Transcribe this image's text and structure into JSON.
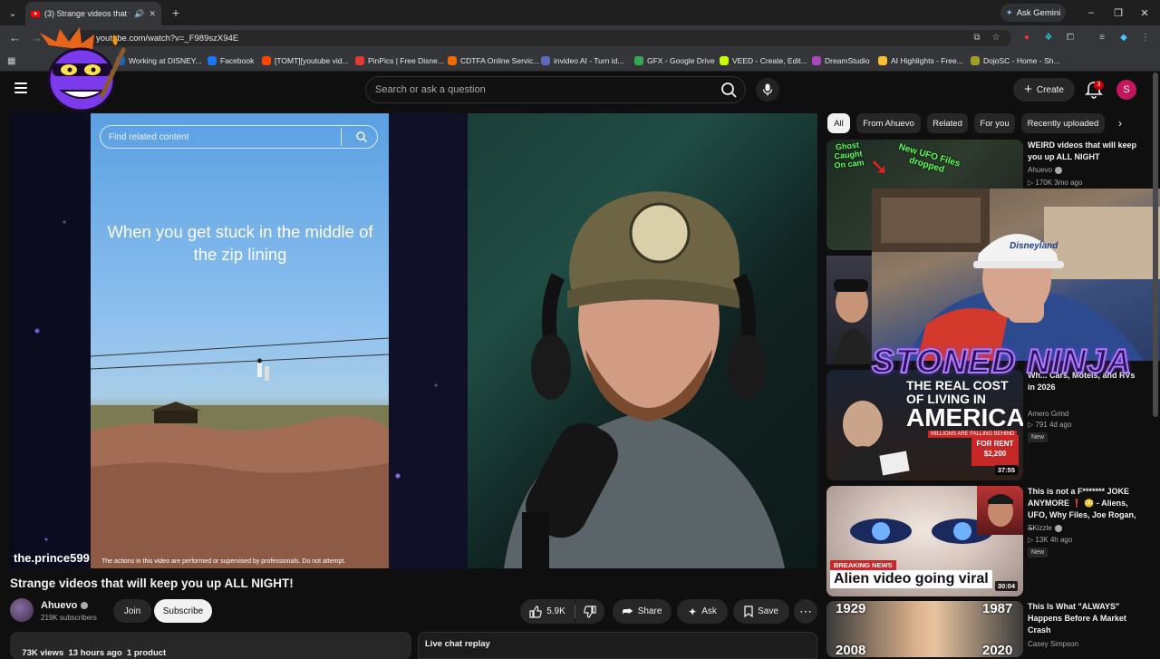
{
  "browser": {
    "tab_title": "(3) Strange videos that will keep you up ALL NIGHT! - YouTube",
    "url": "youtube.com/watch?v=_F989szX94E",
    "ask_gemini": "Ask Gemini",
    "window_minimize": "–",
    "window_maximize": "❐",
    "window_close": "✕",
    "bookmarks": [
      {
        "label": "Working at DISNEY...",
        "color": "#1565c0"
      },
      {
        "label": "Facebook",
        "color": "#1877f2"
      },
      {
        "label": "[TOMT][youtube vid...",
        "color": "#ff4500"
      },
      {
        "label": "PinPics | Free Disne...",
        "color": "#e53935"
      },
      {
        "label": "CDTFA Online Servic...",
        "color": "#ef6c00"
      },
      {
        "label": "invideo AI - Turn id...",
        "color": "#5c6bc0"
      },
      {
        "label": "GFX - Google Drive",
        "color": "#34a853"
      },
      {
        "label": "VEED - Create, Edit...",
        "color": "#c6ff00"
      },
      {
        "label": "DreamStudio",
        "color": "#ab47bc"
      },
      {
        "label": "AI Highlights - Free...",
        "color": "#fbc02d"
      },
      {
        "label": "DojoSC - Home - Sh...",
        "color": "#9e9d24"
      }
    ]
  },
  "header": {
    "search_placeholder": "Search or ask a question",
    "create_label": "Create",
    "notification_count": "3",
    "avatar_letter": "S"
  },
  "player": {
    "phone_search_placeholder": "Find related content",
    "caption": "When you get stuck in the middle of the zip lining",
    "handle": "the.prince599",
    "disclaimer": "The actions in this video are performed or supervised by professionals. Do not attempt."
  },
  "video": {
    "title": "Strange videos that will keep you up ALL NIGHT!",
    "channel": "Ahuevo",
    "subscribers": "219K subscribers",
    "join_label": "Join",
    "subscribe_label": "Subscribe",
    "likes": "5.9K",
    "share_label": "Share",
    "ask_label": "Ask",
    "save_label": "Save",
    "description_line": "73K views  13 hours ago  1 product",
    "live_chat_label": "Live chat replay"
  },
  "chips": [
    "All",
    "From Ahuevo",
    "Related",
    "For you",
    "Recently uploaded"
  ],
  "recommendations": [
    {
      "title": "WEIRD videos that will keep you up ALL NIGHT",
      "channel": "Ahuevo",
      "stats": "▷ 170K  3mo ago",
      "thumb_texts": [
        "Ghost Caught On cam",
        "New UFO Files dropped"
      ]
    },
    {
      "title": "Wh... Cars, Motels, and RVs in 2026",
      "channel": "Amero Grind",
      "stats": "▷ 791  4d ago",
      "badge": "New",
      "duration": "37:55",
      "thumb_texts": [
        "THE REAL COST OF LIVING IN",
        "AMERICA",
        "MILLIONS ARE FALLING BEHIND",
        "FOR RENT $2,200"
      ]
    },
    {
      "title": "This is not a F******* JOKE ANYMORE ❗ 😳 - Aliens, UFO, Why Files, Joe Rogan, ...",
      "channel": "SKizzle",
      "stats": "▷ 13K  4h ago",
      "badge": "New",
      "duration": "30:04",
      "thumb_texts": [
        "BREAKING NEWS",
        "Alien video going viral"
      ]
    },
    {
      "title": "This Is What \"ALWAYS\" Happens Before A Market Crash",
      "channel": "Casey Simpson",
      "thumb_texts": [
        "1929",
        "1987",
        "2008",
        "2020"
      ]
    }
  ],
  "overlay": {
    "brand_text": "STONED NINJA",
    "cap_text": "Disneyland"
  },
  "colors": {
    "background": "#0f0f0f",
    "accent_red": "#ff0000",
    "stoned_outline": "#b07cf5"
  }
}
